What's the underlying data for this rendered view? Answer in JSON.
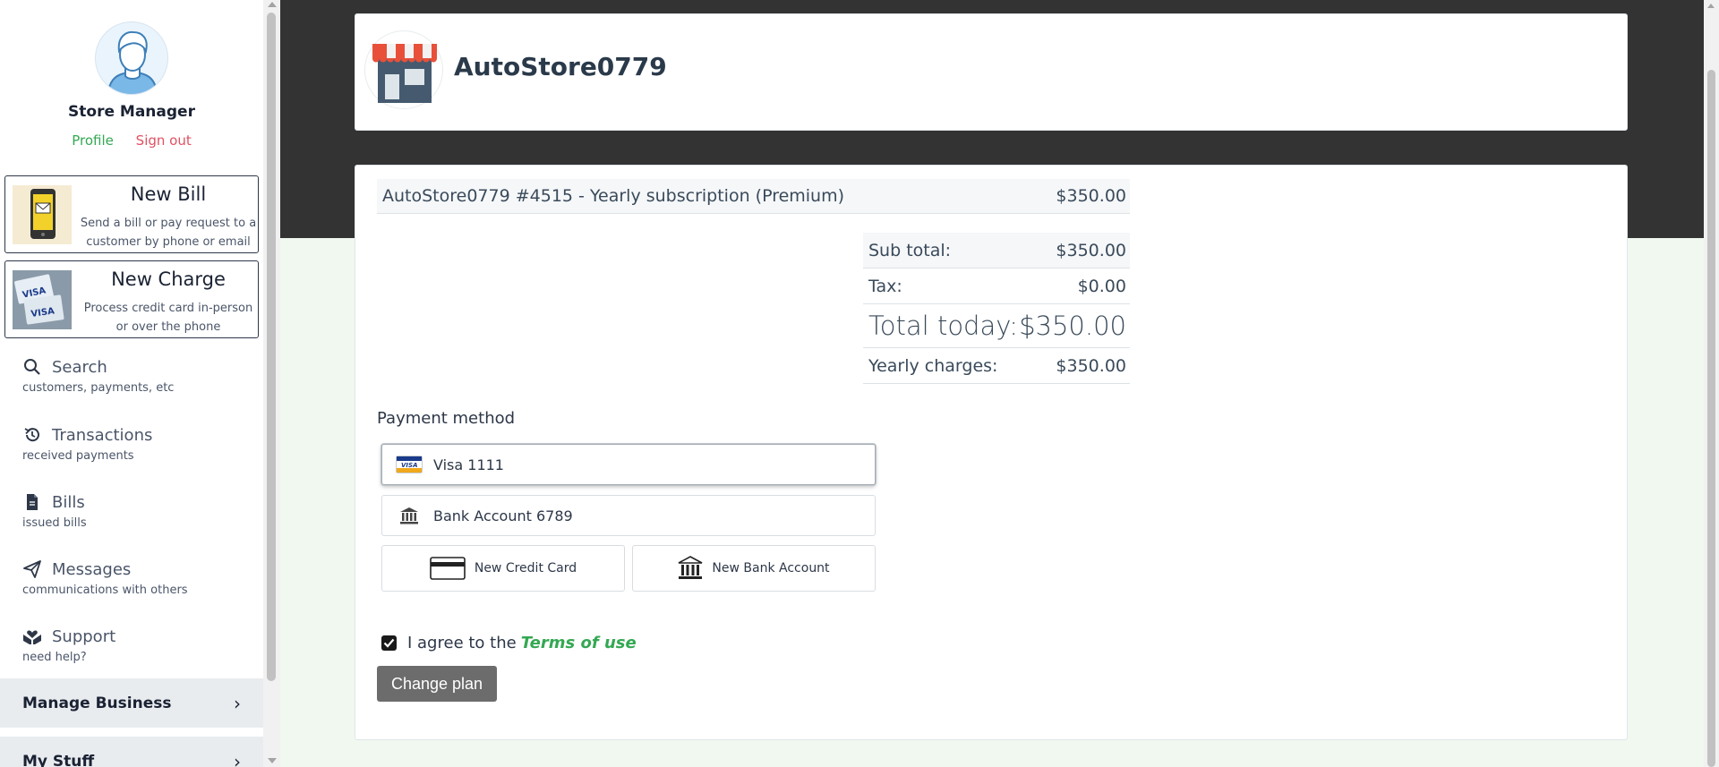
{
  "user": {
    "name": "Store Manager",
    "profile_label": "Profile",
    "signout_label": "Sign out"
  },
  "actions": [
    {
      "title": "New Bill",
      "desc": "Send a bill or pay request to a customer by phone or email"
    },
    {
      "title": "New Charge",
      "desc": "Process credit card in-person or over the phone"
    }
  ],
  "nav": [
    {
      "label": "Search",
      "sub": "customers, payments, etc",
      "icon": "search-icon"
    },
    {
      "label": "Transactions",
      "sub": "received payments",
      "icon": "history-icon"
    },
    {
      "label": "Bills",
      "sub": "issued bills",
      "icon": "document-icon"
    },
    {
      "label": "Messages",
      "sub": "communications with others",
      "icon": "paper-plane-icon"
    },
    {
      "label": "Support",
      "sub": "need help?",
      "icon": "hands-heart-icon"
    }
  ],
  "accordions": [
    {
      "label": "Manage Business"
    },
    {
      "label": "My Stuff"
    }
  ],
  "store": {
    "name": "AutoStore0779"
  },
  "invoice": {
    "line_item": {
      "description": "AutoStore0779 #4515 - Yearly subscription (Premium)",
      "amount": "$350.00"
    },
    "totals": [
      {
        "label": "Sub total:",
        "value": "$350.00"
      },
      {
        "label": "Tax:",
        "value": "$0.00"
      },
      {
        "label": "Total today:",
        "value": "$350.00"
      },
      {
        "label": "Yearly charges:",
        "value": "$350.00"
      }
    ]
  },
  "payment": {
    "label": "Payment method",
    "options": [
      {
        "label": "Visa 1111",
        "icon": "visa-card-icon",
        "selected": true
      },
      {
        "label": "Bank Account 6789",
        "icon": "bank-icon",
        "selected": false
      }
    ],
    "new_credit_card_label": "New Credit Card",
    "new_bank_account_label": "New Bank Account"
  },
  "agree": {
    "text": "I agree to the",
    "link_text": "Terms of use",
    "checked": true
  },
  "submit_label": "Change plan",
  "colors": {
    "accent_green": "#34a853",
    "signout_red": "#e05262",
    "header_dark": "#333333",
    "button_gray": "#6c6c6c"
  }
}
